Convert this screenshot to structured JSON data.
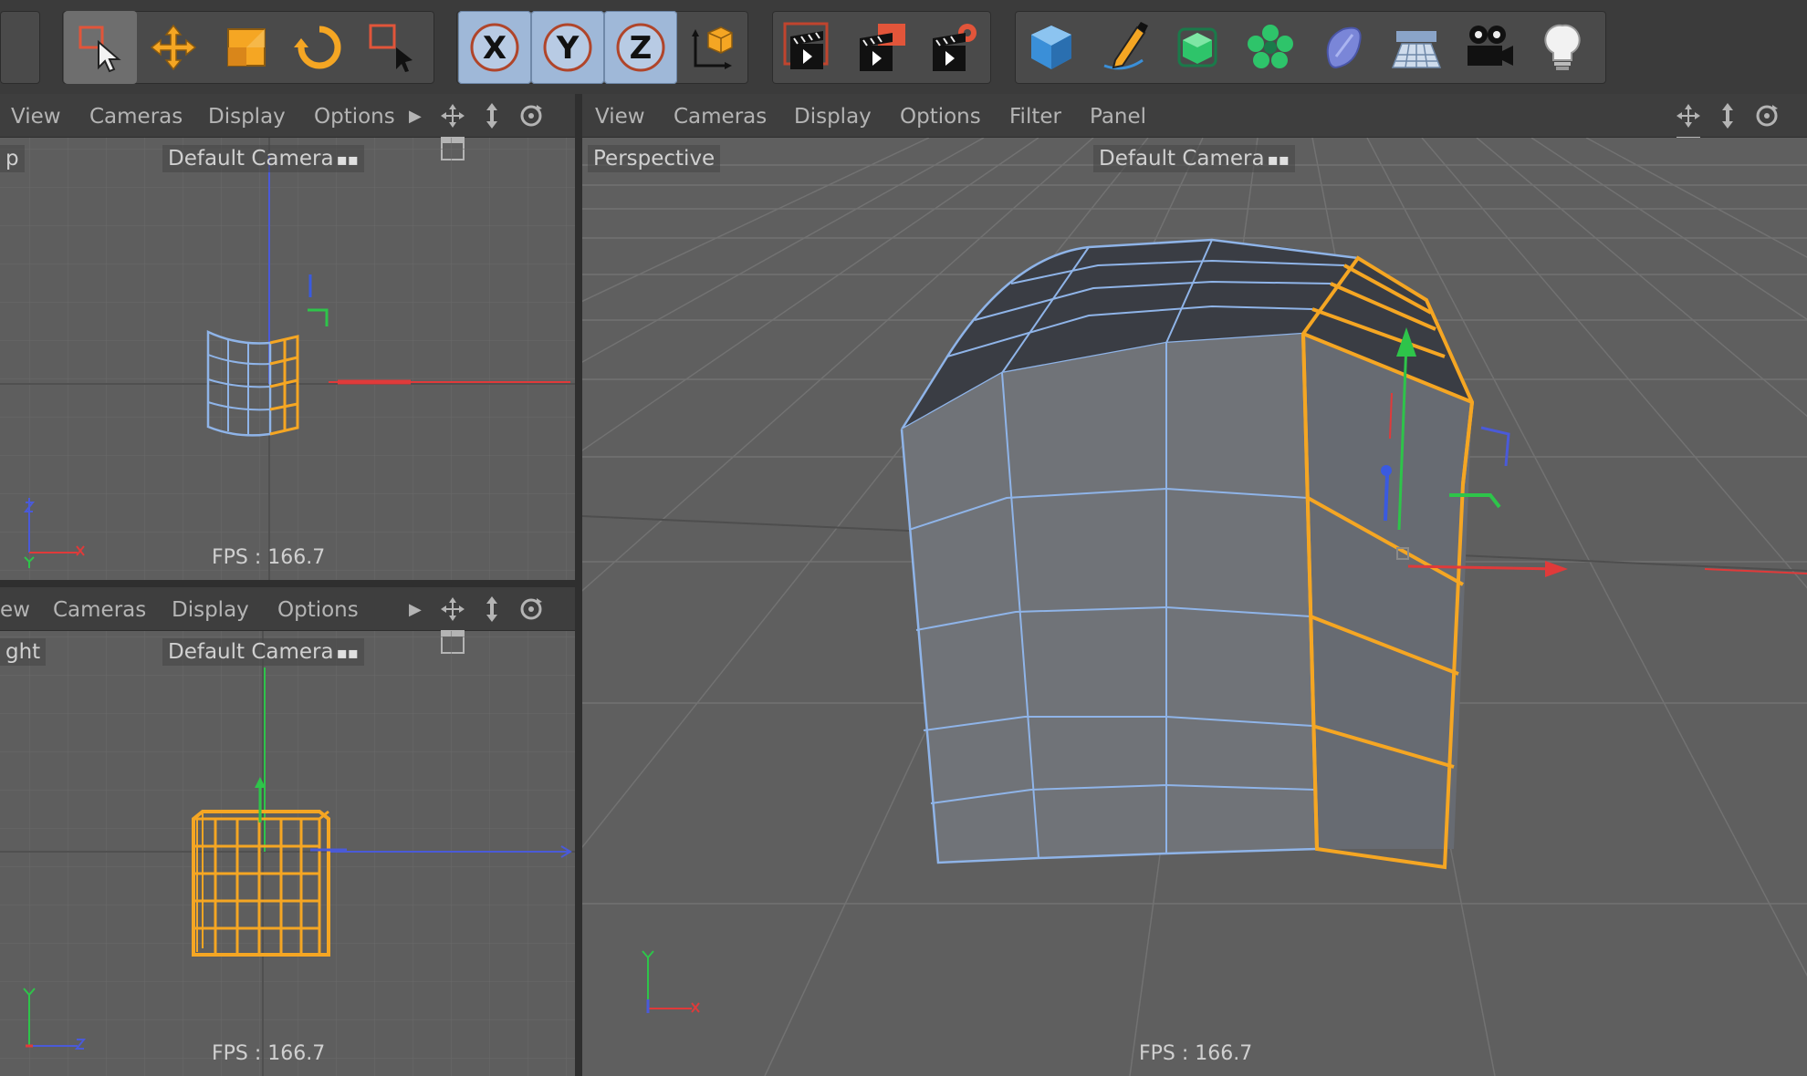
{
  "toolbar": {
    "groups": [
      {
        "name": "selection-tools",
        "items": [
          "live-selection-icon",
          "move-icon",
          "scale-icon",
          "rotate-icon",
          "selection-dropdown-icon"
        ]
      },
      {
        "name": "axis-lock",
        "items": [
          "X",
          "Y",
          "Z",
          "coordinate-system-icon"
        ]
      },
      {
        "name": "render",
        "items": [
          "render-view-icon",
          "render-to-picture-viewer-icon",
          "render-settings-icon"
        ]
      },
      {
        "name": "create",
        "items": [
          "cube-icon",
          "pen-icon",
          "subdivision-surface-icon",
          "cloner-icon",
          "deformer-icon",
          "floor-icon",
          "camera-icon",
          "light-icon"
        ]
      }
    ],
    "axis_labels": {
      "x": "X",
      "y": "Y",
      "z": "Z"
    }
  },
  "viewports": {
    "top": {
      "menu": [
        "View",
        "Cameras",
        "Display",
        "Options"
      ],
      "label": "p",
      "camera": "Default Camera",
      "fps": "FPS : 166.7"
    },
    "right": {
      "menu": [
        "ew",
        "Cameras",
        "Display",
        "Options"
      ],
      "label": "ght",
      "camera": "Default Camera",
      "fps": "FPS : 166.7"
    },
    "perspective": {
      "menu": [
        "View",
        "Cameras",
        "Display",
        "Options",
        "Filter",
        "Panel"
      ],
      "label": "Perspective",
      "camera": "Default Camera",
      "fps": "FPS : 166.7"
    }
  },
  "colors": {
    "selection": "#f5a623",
    "wireframe": "#8fb4e8",
    "axis_x": "#e03a3a",
    "axis_y": "#2ec44a",
    "axis_z": "#3a5ae0",
    "axis_button_fill": "#9fb8d8"
  }
}
